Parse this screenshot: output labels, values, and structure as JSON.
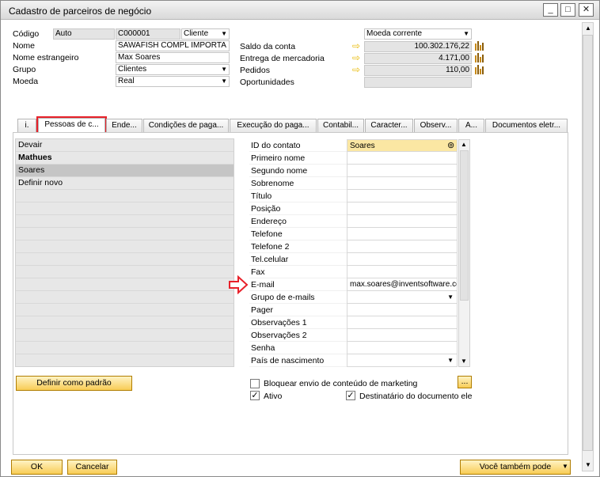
{
  "window": {
    "title": "Cadastro de parceiros de negócio",
    "minimize": "_",
    "maximize": "□",
    "close": "✕"
  },
  "header": {
    "codigo": {
      "label": "Código",
      "series": "Auto",
      "value": "C000001",
      "type": "Cliente"
    },
    "nome": {
      "label": "Nome",
      "value": "SAWAFISH COMPL IMPORTA"
    },
    "nome_estrangeiro": {
      "label": "Nome estrangeiro",
      "value": "Max Soares"
    },
    "grupo": {
      "label": "Grupo",
      "value": "Clientes"
    },
    "moeda": {
      "label": "Moeda",
      "value": "Real"
    },
    "moeda_corrente": "Moeda corrente",
    "saldo": {
      "label": "Saldo da conta",
      "value": "100.302.176,22"
    },
    "entrega": {
      "label": "Entrega de mercadoria",
      "value": "4.171,00"
    },
    "pedidos": {
      "label": "Pedidos",
      "value": "110,00"
    },
    "oportunidades": {
      "label": "Oportunidades",
      "value": ""
    }
  },
  "tabs": [
    {
      "label": "i."
    },
    {
      "label": "Pessoas de c..."
    },
    {
      "label": "Ende..."
    },
    {
      "label": "Condições de paga..."
    },
    {
      "label": "Execução do paga..."
    },
    {
      "label": "Contabil..."
    },
    {
      "label": "Caracter..."
    },
    {
      "label": "Observ..."
    },
    {
      "label": "A..."
    },
    {
      "label": "Documentos eletr..."
    }
  ],
  "contacts": [
    "Devair",
    "Mathues",
    "Soares",
    "Definir novo"
  ],
  "properties": [
    {
      "label": "ID do contato",
      "value": "Soares"
    },
    {
      "label": "Primeiro nome",
      "value": ""
    },
    {
      "label": "Segundo nome",
      "value": ""
    },
    {
      "label": "Sobrenome",
      "value": ""
    },
    {
      "label": "Título",
      "value": ""
    },
    {
      "label": "Posição",
      "value": ""
    },
    {
      "label": "Endereço",
      "value": ""
    },
    {
      "label": "Telefone",
      "value": ""
    },
    {
      "label": "Telefone 2",
      "value": ""
    },
    {
      "label": "Tel.celular",
      "value": ""
    },
    {
      "label": "Fax",
      "value": ""
    },
    {
      "label": "E-mail",
      "value": "max.soares@inventsoftware.co"
    },
    {
      "label": "Grupo de e-mails",
      "value": ""
    },
    {
      "label": "Pager",
      "value": ""
    },
    {
      "label": "Observações 1",
      "value": ""
    },
    {
      "label": "Observações 2",
      "value": ""
    },
    {
      "label": "Senha",
      "value": ""
    },
    {
      "label": "País de nascimento",
      "value": ""
    }
  ],
  "buttons": {
    "definir_padrao": "Definir como padrão",
    "ok": "OK",
    "cancelar": "Cancelar",
    "voce_tambem_pode": "Você também pode",
    "ellipsis": "..."
  },
  "checkboxes": {
    "bloquear": "Bloquear envio de conteúdo de marketing",
    "ativo": "Ativo",
    "destinatario": "Destinatário do documento eletr"
  },
  "colors": {
    "highlight": "#e8212a",
    "button": "#f8cc55",
    "selected_field": "#fbe7a3"
  }
}
